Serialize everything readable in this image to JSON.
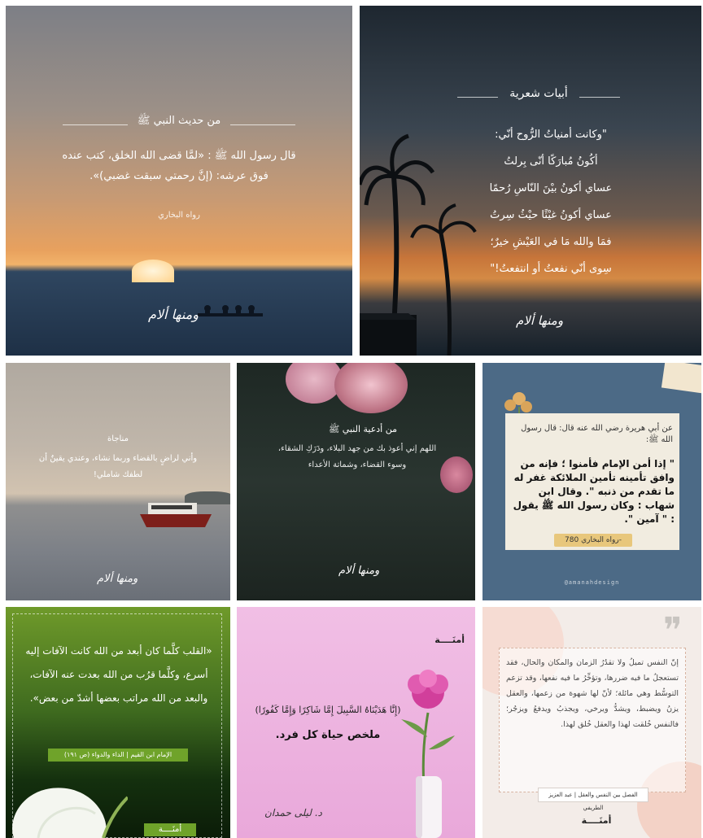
{
  "tiles": {
    "t1": {
      "heading": "من حديث النبي ﷺ",
      "body": "قال رسول الله ﷺ : «لمَّا قضى الله الخلق، كتب عنده فوق عرشه: (إنَّ رحمتي سبقت غضبي)».",
      "source": "رواه البخاري",
      "signature": "ومنها ألام"
    },
    "t2": {
      "heading": "أبيات شعرية",
      "lines": [
        "\"وكانت أمنياتُ الرُّوح أنّي:",
        "أكُونُ مُبارَكًا أنّى بِرلتُ",
        "عساي أكونُ بيْنَ النّاسِ رُحمًا",
        "عساي أكونُ غيْثًا حيْثُ سِرتُ",
        "فمَا والله مَا في العَيْشِ خيرٌ؛",
        "سِوى أنّي نفعتُ أو انتفعتُ!\""
      ],
      "signature": "ومنها ألام"
    },
    "t3": {
      "heading": "مناجاة",
      "body": "وأني لراضٍ بالقضاء وربما نشاء، وعندي يقينٌ أن لطفك شاملي!",
      "signature": "ومنها ألام"
    },
    "t4": {
      "heading": "من أدعية النبي ﷺ",
      "body": "اللهم إني أعوذ بك من جهد البلاء، ودَرَكِ الشقاء، وسوء القضاء، وشماتة الأعداء",
      "signature": "ومنها ألام"
    },
    "t5": {
      "intro": "عن أبي هريرة رضي الله عنه قال: قال رسول الله ﷺ:",
      "body": "\" إذا أمن الإمام فأمنوا ؛ فإنه من وافق تأمينه تأمين الملائكة غفر له ما تقدم من ذنبه \". وقال ابن شهاب : وكان رسول الله ﷺ يقول : \" آمين \".",
      "source": "-رواه البخاري 780",
      "handle": "@amanahdesign"
    },
    "t6": {
      "body": "«القلب كلَّما كان أبعد من الله كانت الآفات إليه أسرع، وكلَّما قرُب من الله بعدت عنه الآفات، والبعد من الله مراتب بعضها أشدّ من بعض».",
      "source": "الإمام ابن القيم | الداء والدواء (ص ١٩١)",
      "brand": "أمنَــــة"
    },
    "t7": {
      "brand": "أمنَــــة",
      "verse": "(إِنَّا هَدَيْنَاهُ السَّبِيلَ إِمَّا شَاكِرًا وَإِمَّا كَفُورًا)",
      "caption": "ملخص حياة كل فرد.",
      "author": "د. ليلى حمدان"
    },
    "t8": {
      "quote_mark": "❞",
      "body": "إنّ النفس تميلُ ولا تقدُرُ الزمان والمكان والحال، فقد تستعجلُ ما فيه ضررها، وتؤخِّرُ ما فيه نفعها، وقد تزعم التوسُّط وهي مائلة؛ لأنّ لها شهوة من زعمها، والعقل يزنُ ويضبط، ويشدُّ ويرخي، ويجذبُ ويدفعُ ويزجُر؛ فالنفس خُلقت لهذا والعقل خُلق لهذا.",
      "source": "الفصل بين النفس والعقل | عبد العزيز الطريفي",
      "brand": "أمنَــــة"
    }
  },
  "colors": {
    "t5_card": "#f1ece0",
    "t5_bg": "#4c6a86",
    "t6_source_bg": "#6fa32a",
    "t8_border": "#d8b4a2"
  }
}
